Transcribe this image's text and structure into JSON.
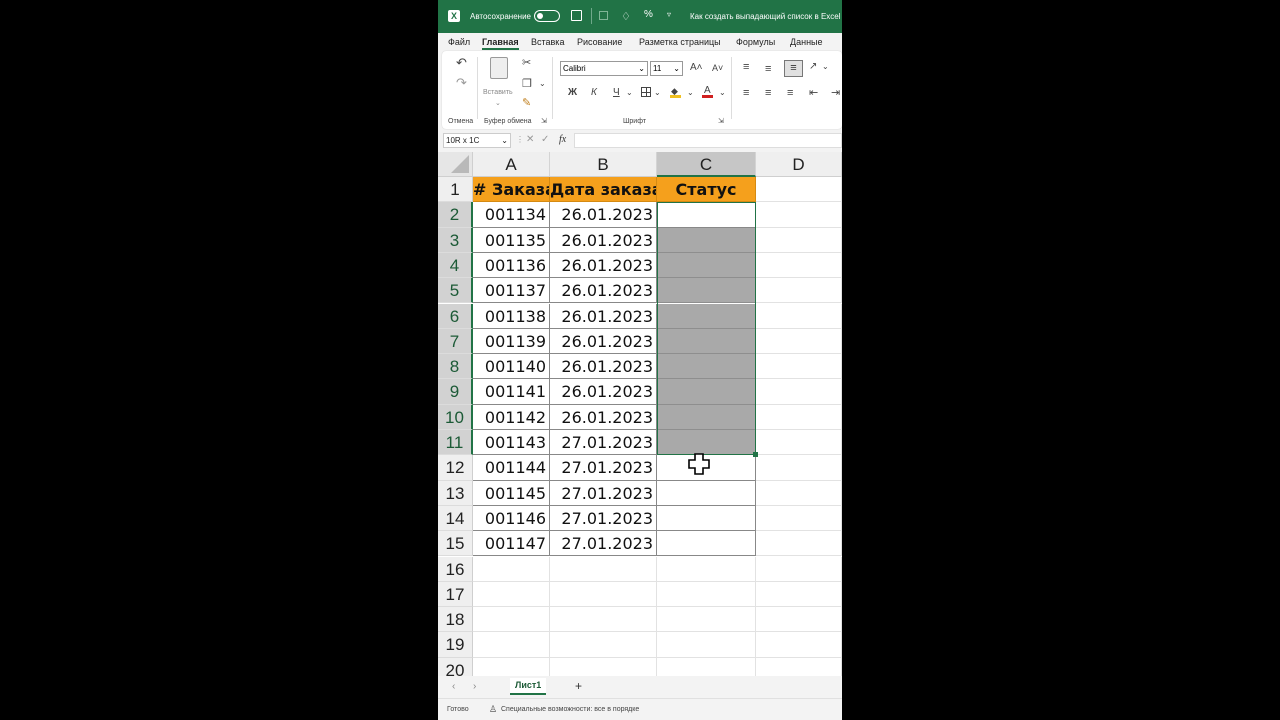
{
  "titlebar": {
    "autosave_label": "Автосохранение",
    "doc_title": "Как создать выпадающий список в Excel"
  },
  "menu": [
    "Файл",
    "Главная",
    "Вставка",
    "Рисование",
    "Разметка страницы",
    "Формулы",
    "Данные"
  ],
  "ribbon": {
    "undo_group": "Отмена",
    "paste_label": "Вставить",
    "clipboard_group": "Буфер обмена",
    "font_name": "Calibri",
    "font_size": "11",
    "grow_font": "A˄",
    "shrink_font": "A˅",
    "bold": "Ж",
    "italic": "К",
    "underline": "Ч",
    "font_group": "Шрифт"
  },
  "formula_bar": {
    "name_box": "10R x 1C",
    "fx": "fx",
    "value": ""
  },
  "columns": [
    "A",
    "B",
    "C",
    "D"
  ],
  "rows": [
    "1",
    "2",
    "3",
    "4",
    "5",
    "6",
    "7",
    "8",
    "9",
    "10",
    "11",
    "12",
    "13",
    "14",
    "15",
    "16",
    "17",
    "18",
    "19",
    "20"
  ],
  "table": {
    "headers": [
      "# Заказа",
      "Дата заказа",
      "Статус"
    ],
    "rows": [
      [
        "001134",
        "26.01.2023",
        ""
      ],
      [
        "001135",
        "26.01.2023",
        ""
      ],
      [
        "001136",
        "26.01.2023",
        ""
      ],
      [
        "001137",
        "26.01.2023",
        ""
      ],
      [
        "001138",
        "26.01.2023",
        ""
      ],
      [
        "001139",
        "26.01.2023",
        ""
      ],
      [
        "001140",
        "26.01.2023",
        ""
      ],
      [
        "001141",
        "26.01.2023",
        ""
      ],
      [
        "001142",
        "26.01.2023",
        ""
      ],
      [
        "001143",
        "27.01.2023",
        ""
      ],
      [
        "001144",
        "27.01.2023",
        ""
      ],
      [
        "001145",
        "27.01.2023",
        ""
      ],
      [
        "001146",
        "27.01.2023",
        ""
      ],
      [
        "001147",
        "27.01.2023",
        ""
      ]
    ]
  },
  "sheet_tabs": {
    "active": "Лист1",
    "add": "+"
  },
  "status_bar": {
    "ready": "Готово",
    "accessibility": "Специальные возможности: все в порядке"
  },
  "colors": {
    "excel_green": "#217346",
    "header_orange": "#f5a01c",
    "selection_gray": "#a9a9a9"
  }
}
